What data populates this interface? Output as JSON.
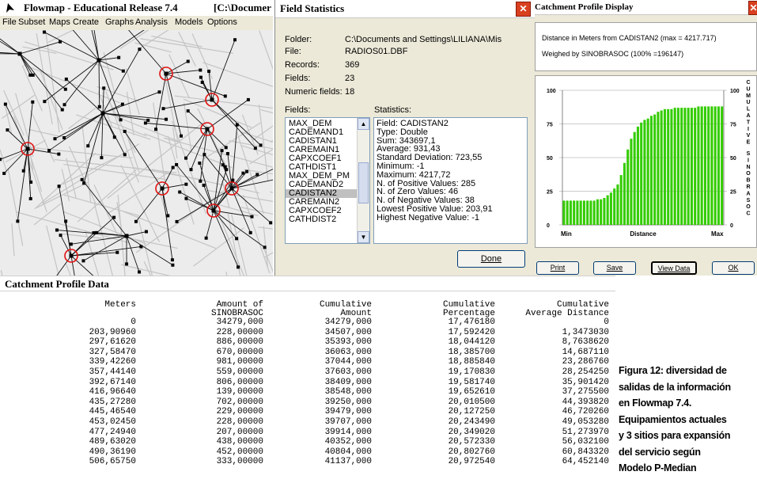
{
  "flowmap": {
    "title": "Flowmap - Educational Release 7.4",
    "path": "[C:\\Documer",
    "menu": [
      "File",
      "Subset",
      "Maps",
      "Create",
      "Graphs",
      "Analysis",
      "Models",
      "Options"
    ]
  },
  "field_stats": {
    "title": "Field Statistics",
    "folder_label": "Folder:",
    "folder_value": "C:\\Documents and Settings\\LILIANA\\Mis",
    "file_label": "File:",
    "file_value": "RADIOS01.DBF",
    "records_label": "Records:",
    "records_value": "369",
    "fields_label": "Fields:",
    "fields_value": "23",
    "numeric_label": "Numeric fields:",
    "numeric_value": "18",
    "fields_list_label": "Fields:",
    "stats_label": "Statistics:",
    "fields_list": [
      "MAX_DEM",
      "CADEMAND1",
      "CADISTAN1",
      "CAREMAIN1",
      "CAPXCOEF1",
      "CATHDIST1",
      "MAX_DEM_PM",
      "CADEMAND2",
      "CADISTAN2",
      "CAREMAIN2",
      "CAPXCOEF2",
      "CATHDIST2"
    ],
    "selected_field": "CADISTAN2",
    "statistics": [
      "Field: CADISTAN2",
      "Type: Double",
      "Sum: 343697,1",
      "Average: 931,43",
      "Standard Deviation: 723,55",
      "Minimum: -1",
      "Maximum: 4217,72",
      "N. of Positive Values: 285",
      "N. of Zero Values: 46",
      "N. of Negative Values: 38",
      "Lowest Positive Value: 203,91",
      "Highest Negative Value: -1"
    ],
    "done_label": "Done"
  },
  "profile_display": {
    "title": "Catchment Profile Display",
    "info_line1": "Distance in Meters from CADISTAN2 (max = 4217.717)",
    "info_line2": "Weighed by SINOBRASOC (100% =196147)",
    "right_axis_label": "CUMULATIVE SINOBRASOC",
    "y_ticks": [
      "100",
      "75",
      "50",
      "25",
      "0"
    ],
    "x_min_label": "Min",
    "x_mid_label": "Distance",
    "x_max_label": "Max",
    "buttons": [
      "Print",
      "Save",
      "View Data",
      "OK"
    ]
  },
  "chart_data": {
    "type": "bar",
    "title": "",
    "xlabel": "Distance",
    "ylabel": "CUMULATIVE SINOBRASOC",
    "ylim": [
      0,
      100
    ],
    "bar_color": "#33cc00",
    "values": [
      18,
      18,
      18,
      18,
      18,
      18,
      18,
      18,
      18,
      18,
      19,
      19,
      20,
      22,
      24,
      27,
      30,
      37,
      46,
      56,
      64,
      69,
      73,
      76,
      78,
      79,
      81,
      82,
      84,
      85,
      86,
      86,
      86,
      87,
      87,
      87,
      87,
      87,
      87,
      87,
      88,
      88,
      88,
      88,
      88,
      88,
      88,
      88
    ]
  },
  "profile_data": {
    "title": "Catchment Profile Data",
    "headers": [
      [
        "Meters",
        ""
      ],
      [
        "Amount of",
        "SINOBRASOC"
      ],
      [
        "Cumulative",
        "Amount"
      ],
      [
        "Cumulative",
        "Percentage"
      ],
      [
        "Cumulative",
        "Average Distance"
      ]
    ],
    "rows": [
      [
        "0",
        "34279,000",
        "34279,000",
        "17,476180",
        "0"
      ],
      [
        "203,90960",
        "228,00000",
        "34507,000",
        "17,592420",
        "1,3473030"
      ],
      [
        "297,61620",
        "886,00000",
        "35393,000",
        "18,044120",
        "8,7638620"
      ],
      [
        "327,58470",
        "670,00000",
        "36063,000",
        "18,385700",
        "14,687110"
      ],
      [
        "339,42260",
        "981,00000",
        "37044,000",
        "18,885840",
        "23,286760"
      ],
      [
        "357,44140",
        "559,00000",
        "37603,000",
        "19,170830",
        "28,254250"
      ],
      [
        "392,67140",
        "806,00000",
        "38409,000",
        "19,581740",
        "35,901420"
      ],
      [
        "416,96640",
        "139,00000",
        "38548,000",
        "19,652610",
        "37,275500"
      ],
      [
        "435,27280",
        "702,00000",
        "39250,000",
        "20,010500",
        "44,393820"
      ],
      [
        "445,46540",
        "229,00000",
        "39479,000",
        "20,127250",
        "46,720260"
      ],
      [
        "453,02450",
        "228,00000",
        "39707,000",
        "20,243490",
        "49,053280"
      ],
      [
        "477,24940",
        "207,00000",
        "39914,000",
        "20,349020",
        "51,273970"
      ],
      [
        "489,63020",
        "438,00000",
        "40352,000",
        "20,572330",
        "56,032100"
      ],
      [
        "490,36190",
        "452,00000",
        "40804,000",
        "20,802760",
        "60,843320"
      ],
      [
        "506,65750",
        "333,00000",
        "41137,000",
        "20,972540",
        "64,452140"
      ]
    ]
  },
  "caption": {
    "lines": [
      "Figura 12: diversidad de",
      "salidas de la información",
      "en Flowmap 7.4.",
      "Equipamientos actuales",
      "y 3 sitios para expansión",
      "del servicio según",
      "Modelo P-Median"
    ]
  }
}
